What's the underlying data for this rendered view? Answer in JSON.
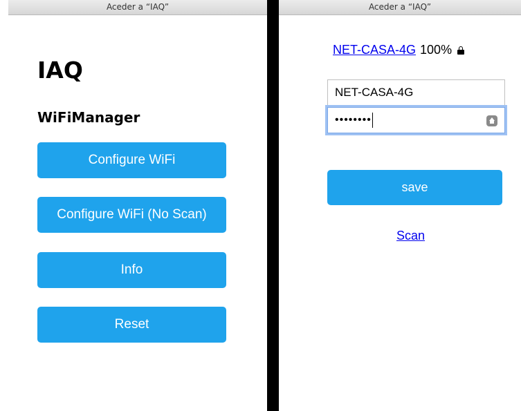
{
  "left_window": {
    "title": "Aceder a “IAQ”",
    "app_title": "IAQ",
    "subtitle": "WiFiManager",
    "buttons": [
      "Configure WiFi",
      "Configure WiFi (No Scan)",
      "Info",
      "Reset"
    ]
  },
  "right_window": {
    "title": "Aceder a “IAQ”",
    "network": {
      "ssid": "NET-CASA-4G",
      "signal": "100%",
      "secured_icon": "lock-icon"
    },
    "ssid_input_value": "NET-CASA-4G",
    "password_masked": "••••••••",
    "password_icon": "password-key-icon",
    "save_label": "save",
    "scan_label": "Scan"
  },
  "colors": {
    "button": "#1fa3ec",
    "link": "#0000ee",
    "divider": "#000000"
  }
}
